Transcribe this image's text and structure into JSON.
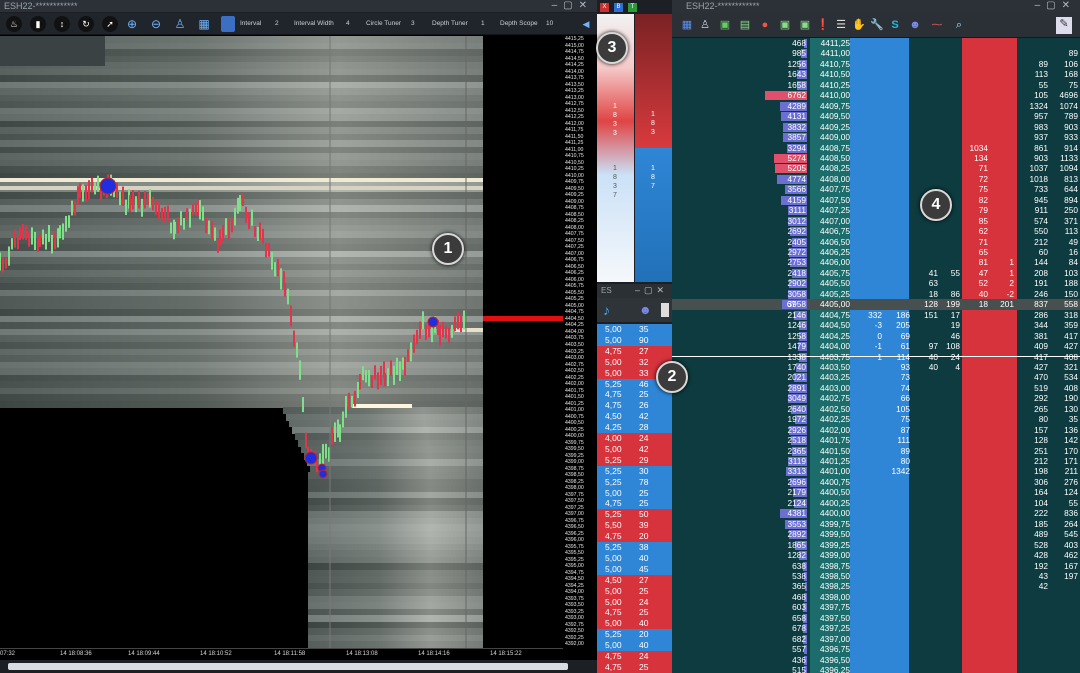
{
  "left_window": {
    "title": "ESH22-************",
    "toolbar": {
      "interval_label": "Interval",
      "interval_value": "2",
      "interval_width_label": "Interval Width",
      "interval_width_value": "4",
      "circle_tuner_label": "Circle Tuner",
      "circle_tuner_value": "3",
      "depth_tuner_label": "Depth Tuner",
      "depth_tuner_value": "1",
      "depth_scope_label": "Depth Scope",
      "depth_scope_value": "10"
    },
    "price_ticks": [
      "4415,25",
      "4415,00",
      "4414,75",
      "4414,50",
      "4414,25",
      "4414,00",
      "4413,75",
      "4413,50",
      "4413,25",
      "4413,00",
      "4412,75",
      "4412,50",
      "4412,25",
      "4412,00",
      "4411,75",
      "4411,50",
      "4411,25",
      "4411,00",
      "4410,75",
      "4410,50",
      "4410,25",
      "4410,00",
      "4409,75",
      "4409,50",
      "4409,25",
      "4409,00",
      "4408,75",
      "4408,50",
      "4408,25",
      "4408,00",
      "4407,75",
      "4407,50",
      "4407,25",
      "4407,00",
      "4406,75",
      "4406,50",
      "4406,25",
      "4406,00",
      "4405,75",
      "4405,50",
      "4405,25",
      "4405,00",
      "4404,75",
      "4404,50",
      "4404,25",
      "4404,00",
      "4403,75",
      "4403,50",
      "4403,25",
      "4403,00",
      "4402,75",
      "4402,50",
      "4402,25",
      "4402,00",
      "4401,75",
      "4401,50",
      "4401,25",
      "4401,00",
      "4400,75",
      "4400,50",
      "4400,25",
      "4400,00",
      "4399,75",
      "4399,50",
      "4399,25",
      "4399,00",
      "4398,75",
      "4398,50",
      "4398,25",
      "4398,00",
      "4397,75",
      "4397,50",
      "4397,25",
      "4397,00",
      "4396,75",
      "4396,50",
      "4396,25",
      "4396,00",
      "4395,75",
      "4395,50",
      "4395,25",
      "4395,00",
      "4394,75",
      "4394,50",
      "4394,25",
      "4394,00",
      "4393,75",
      "4393,50",
      "4393,25",
      "4393,00",
      "4392,75",
      "4392,50",
      "4392,25",
      "4392,00"
    ],
    "time_ticks": [
      "07:32",
      "14 18:08:36",
      "14 18:09:44",
      "14 18:10:52",
      "14 18:11:58",
      "14 18:13:08",
      "14 18:14:16",
      "14 18:15:22"
    ]
  },
  "middle": {
    "gauge_left_text": "1\n8\n3\n3",
    "gauge_right_top": "1\n8\n3",
    "gauge_right_bottom": "1\n8\n7",
    "gauge_left_bottom": "1\n8\n3\n7",
    "window_title": "ES",
    "trades": [
      {
        "p": "5,00",
        "s": "35",
        "side": "buy"
      },
      {
        "p": "5,00",
        "s": "90",
        "side": "buy"
      },
      {
        "p": "4,75",
        "s": "27",
        "side": "sell"
      },
      {
        "p": "5,00",
        "s": "32",
        "side": "sell"
      },
      {
        "p": "5,00",
        "s": "33",
        "side": "sell"
      },
      {
        "p": "5,25",
        "s": "46",
        "side": "buy"
      },
      {
        "p": "4,75",
        "s": "25",
        "side": "buy"
      },
      {
        "p": "4,75",
        "s": "26",
        "side": "buy"
      },
      {
        "p": "4,50",
        "s": "42",
        "side": "buy"
      },
      {
        "p": "4,25",
        "s": "28",
        "side": "buy"
      },
      {
        "p": "4,00",
        "s": "24",
        "side": "sell"
      },
      {
        "p": "5,00",
        "s": "42",
        "side": "sell"
      },
      {
        "p": "5,25",
        "s": "29",
        "side": "sell"
      },
      {
        "p": "5,25",
        "s": "30",
        "side": "buy"
      },
      {
        "p": "5,25",
        "s": "78",
        "side": "buy"
      },
      {
        "p": "5,00",
        "s": "25",
        "side": "buy"
      },
      {
        "p": "4,75",
        "s": "25",
        "side": "buy"
      },
      {
        "p": "5,25",
        "s": "50",
        "side": "sell"
      },
      {
        "p": "5,50",
        "s": "39",
        "side": "sell"
      },
      {
        "p": "4,75",
        "s": "20",
        "side": "sell"
      },
      {
        "p": "5,25",
        "s": "38",
        "side": "buy"
      },
      {
        "p": "5,00",
        "s": "40",
        "side": "buy"
      },
      {
        "p": "5,00",
        "s": "45",
        "side": "buy"
      },
      {
        "p": "4,50",
        "s": "27",
        "side": "sell"
      },
      {
        "p": "5,00",
        "s": "25",
        "side": "sell"
      },
      {
        "p": "5,00",
        "s": "24",
        "side": "sell"
      },
      {
        "p": "4,75",
        "s": "25",
        "side": "sell"
      },
      {
        "p": "5,00",
        "s": "40",
        "side": "sell"
      },
      {
        "p": "5,25",
        "s": "20",
        "side": "buy"
      },
      {
        "p": "5,00",
        "s": "40",
        "side": "buy"
      },
      {
        "p": "4,75",
        "s": "24",
        "side": "sell"
      },
      {
        "p": "4,75",
        "s": "25",
        "side": "sell"
      }
    ]
  },
  "dom_window": {
    "title": "ESH22-************",
    "rows": [
      {
        "v": "468",
        "p": "4411,25",
        "c7": "",
        "c8": ""
      },
      {
        "v": "985",
        "p": "4411,00",
        "c7": "",
        "c8": "89"
      },
      {
        "v": "1256",
        "p": "4410,75",
        "c7": "89",
        "c8": "106"
      },
      {
        "v": "1643",
        "p": "4410,50",
        "c7": "113",
        "c8": "168"
      },
      {
        "v": "1658",
        "p": "4410,25",
        "c7": "55",
        "c8": "75"
      },
      {
        "v": "6762",
        "p": "4410,00",
        "c7": "105",
        "c8": "4696"
      },
      {
        "v": "4289",
        "p": "4409,75",
        "c7": "1324",
        "c8": "1074"
      },
      {
        "v": "4131",
        "p": "4409,50",
        "c7": "957",
        "c8": "789"
      },
      {
        "v": "3832",
        "p": "4409,25",
        "c7": "983",
        "c8": "903"
      },
      {
        "v": "3857",
        "p": "4409,00",
        "c7": "937",
        "c8": "933"
      },
      {
        "v": "3294",
        "p": "4408,75",
        "c4": "1034",
        "c7": "861",
        "c8": "914"
      },
      {
        "v": "5274",
        "p": "4408,50",
        "c4": "134",
        "c7": "903",
        "c8": "1133"
      },
      {
        "v": "5205",
        "p": "4408,25",
        "c4": "71",
        "c7": "1037",
        "c8": "1094"
      },
      {
        "v": "4774",
        "p": "4408,00",
        "c4": "72",
        "c7": "1018",
        "c8": "813"
      },
      {
        "v": "3566",
        "p": "4407,75",
        "c4": "75",
        "c7": "733",
        "c8": "644"
      },
      {
        "v": "4159",
        "p": "4407,50",
        "c4": "82",
        "c7": "945",
        "c8": "894"
      },
      {
        "v": "3111",
        "p": "4407,25",
        "c4": "79",
        "c7": "911",
        "c8": "250"
      },
      {
        "v": "3012",
        "p": "4407,00",
        "c4": "85",
        "c7": "574",
        "c8": "371"
      },
      {
        "v": "2692",
        "p": "4406,75",
        "c4": "62",
        "c7": "550",
        "c8": "113"
      },
      {
        "v": "2405",
        "p": "4406,50",
        "c4": "71",
        "c7": "212",
        "c8": "49"
      },
      {
        "v": "2972",
        "p": "4406,25",
        "c4": "65",
        "c7": "60",
        "c8": "16"
      },
      {
        "v": "2753",
        "p": "4406,00",
        "c4": "81",
        "c5": "1",
        "c7": "144",
        "c8": "84"
      },
      {
        "v": "2418",
        "p": "4405,75",
        "c2": "41",
        "c3": "55",
        "c4": "47",
        "c5": "1",
        "c7": "208",
        "c8": "103"
      },
      {
        "v": "2902",
        "p": "4405,50",
        "c2": "63",
        "c4": "52",
        "c5": "2",
        "c7": "191",
        "c8": "188"
      },
      {
        "v": "3058",
        "p": "4405,25",
        "c2": "18",
        "c3": "86",
        "c4": "40",
        "c5": "-2",
        "c7": "246",
        "c8": "150"
      },
      {
        "v": "3958",
        "p": "4405,00",
        "pre": "67",
        "c2": "128",
        "c3": "199",
        "c4": "18",
        "c5": "201",
        "c7": "837",
        "c8": "558",
        "cur": true
      },
      {
        "v": "2146",
        "p": "4404,75",
        "c0": "332",
        "c1": "186",
        "c2": "151",
        "c3": "17",
        "c7": "286",
        "c8": "318"
      },
      {
        "v": "1246",
        "p": "4404,50",
        "c0": "-3",
        "c1": "205",
        "c3": "19",
        "c7": "344",
        "c8": "359"
      },
      {
        "v": "1258",
        "p": "4404,25",
        "c0": "0",
        "c1": "69",
        "c3": "46",
        "c7": "381",
        "c8": "417"
      },
      {
        "v": "1479",
        "p": "4404,00",
        "c0": "-1",
        "c1": "61",
        "c2": "97",
        "c3": "108",
        "c7": "409",
        "c8": "427"
      },
      {
        "v": "1338",
        "p": "4403,75",
        "c0": "1",
        "c1": "114",
        "c2": "40",
        "c3": "24",
        "c7": "417",
        "c8": "408"
      },
      {
        "v": "1740",
        "p": "4403,50",
        "c1": "93",
        "c2": "40",
        "c3": "4",
        "c7": "427",
        "c8": "321"
      },
      {
        "v": "2021",
        "p": "4403,25",
        "c1": "73",
        "c7": "470",
        "c8": "534"
      },
      {
        "v": "2891",
        "p": "4403,00",
        "c1": "74",
        "c7": "519",
        "c8": "408"
      },
      {
        "v": "3049",
        "p": "4402,75",
        "c1": "66",
        "c7": "292",
        "c8": "190"
      },
      {
        "v": "2640",
        "p": "4402,50",
        "c1": "105",
        "c7": "265",
        "c8": "130"
      },
      {
        "v": "1972",
        "p": "4402,25",
        "c1": "75",
        "c7": "80",
        "c8": "35"
      },
      {
        "v": "2926",
        "p": "4402,00",
        "c1": "87",
        "c7": "157",
        "c8": "136"
      },
      {
        "v": "2518",
        "p": "4401,75",
        "c1": "111",
        "c7": "128",
        "c8": "142"
      },
      {
        "v": "2365",
        "p": "4401,50",
        "c1": "89",
        "c7": "251",
        "c8": "170"
      },
      {
        "v": "3119",
        "p": "4401,25",
        "c1": "80",
        "c7": "212",
        "c8": "171"
      },
      {
        "v": "3313",
        "p": "4401,00",
        "c1": "1342",
        "c7": "198",
        "c8": "211"
      },
      {
        "v": "2696",
        "p": "4400,75",
        "c7": "306",
        "c8": "276"
      },
      {
        "v": "2179",
        "p": "4400,50",
        "c7": "164",
        "c8": "124"
      },
      {
        "v": "2124",
        "p": "4400,25",
        "c7": "104",
        "c8": "55"
      },
      {
        "v": "4381",
        "p": "4400,00",
        "c7": "222",
        "c8": "836"
      },
      {
        "v": "3553",
        "p": "4399,75",
        "c7": "185",
        "c8": "264"
      },
      {
        "v": "2892",
        "p": "4399,50",
        "c7": "489",
        "c8": "545"
      },
      {
        "v": "1865",
        "p": "4399,25",
        "c7": "528",
        "c8": "403"
      },
      {
        "v": "1282",
        "p": "4399,00",
        "c7": "428",
        "c8": "462"
      },
      {
        "v": "638",
        "p": "4398,75",
        "c7": "192",
        "c8": "167"
      },
      {
        "v": "538",
        "p": "4398,50",
        "c7": "43",
        "c8": "197"
      },
      {
        "v": "365",
        "p": "4398,25",
        "c7": "42",
        "c8": ""
      },
      {
        "v": "468",
        "p": "4398,00"
      },
      {
        "v": "603",
        "p": "4397,75"
      },
      {
        "v": "658",
        "p": "4397,50"
      },
      {
        "v": "678",
        "p": "4397,25"
      },
      {
        "v": "682",
        "p": "4397,00"
      },
      {
        "v": "557",
        "p": "4396,75"
      },
      {
        "v": "436",
        "p": "4396,50"
      },
      {
        "v": "515",
        "p": "4396,25"
      },
      {
        "v": "609",
        "p": "4396,00"
      }
    ]
  },
  "badges": {
    "one": "1",
    "two": "2",
    "three": "3",
    "four": "4"
  },
  "colors": {
    "buy": "#2f86d6",
    "sell": "#d6333c",
    "teal": "#0d3b3f",
    "volume_bar": "#5a5fc9"
  }
}
